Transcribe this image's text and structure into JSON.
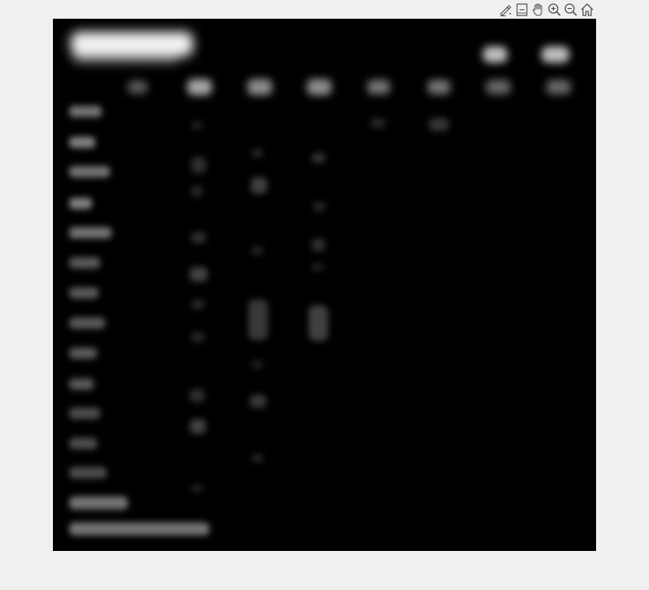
{
  "toolbar": {
    "tools": [
      {
        "name": "brush-icon",
        "tooltip": ""
      },
      {
        "name": "datatip-icon",
        "tooltip": ""
      },
      {
        "name": "pan-hand-icon",
        "tooltip": ""
      },
      {
        "name": "zoom-in-icon",
        "tooltip": ""
      },
      {
        "name": "zoom-out-icon",
        "tooltip": ""
      },
      {
        "name": "home-icon",
        "tooltip": ""
      }
    ]
  },
  "colors": {
    "window_background": "#f0f0f0",
    "image_background": "#000000",
    "icon_stroke": "#555555",
    "blob_color": "#ffffff"
  },
  "image": {
    "description_visible": false
  }
}
